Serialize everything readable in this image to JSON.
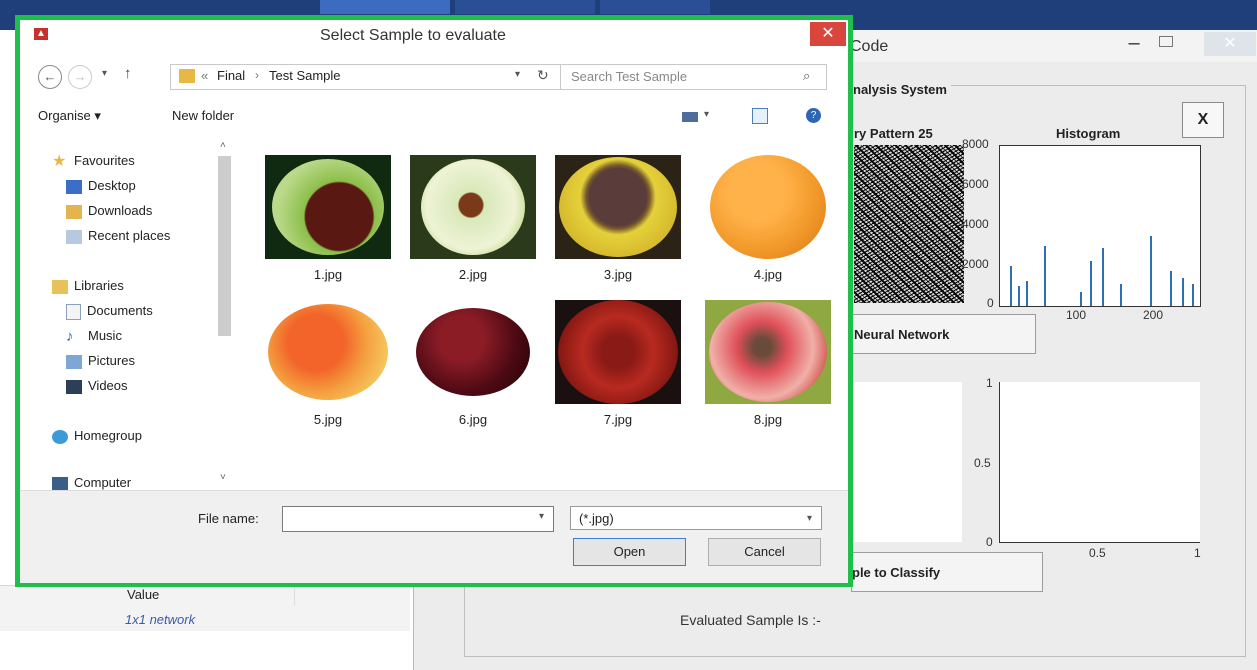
{
  "background": {
    "left_panel": {
      "value_header": "Value",
      "value_cell": "1x1 network"
    },
    "app_window": {
      "title": "Code",
      "system_title": "nalysis System",
      "close_x": "X",
      "lbp_title": "ry Pattern 25",
      "histogram_title": "Histogram",
      "histogram_yticks": [
        "8000",
        "6000",
        "4000",
        "2000",
        "0"
      ],
      "histogram_xticks": [
        "100",
        "200"
      ],
      "nn_button": "Neural Network",
      "plot_yticks": [
        "1",
        "0.5",
        "0"
      ],
      "plot_xticks": [
        "0.5",
        "1"
      ],
      "classify_button": "ple to Classify",
      "evaluated_label": "Evaluated Sample Is :-"
    }
  },
  "dialog": {
    "title": "Select Sample to evaluate",
    "close": "✕",
    "breadcrumb": [
      "«",
      "Final",
      "›",
      "Test Sample"
    ],
    "search_placeholder": "Search Test Sample",
    "organise": "Organise ▾",
    "new_folder": "New folder",
    "nav": {
      "favourites": "Favourites",
      "desktop": "Desktop",
      "downloads": "Downloads",
      "recent": "Recent places",
      "libraries": "Libraries",
      "documents": "Documents",
      "music": "Music",
      "pictures": "Pictures",
      "videos": "Videos",
      "homegroup": "Homegroup",
      "computer": "Computer"
    },
    "files": [
      "1.jpg",
      "2.jpg",
      "3.jpg",
      "4.jpg",
      "5.jpg",
      "6.jpg",
      "7.jpg",
      "8.jpg"
    ],
    "file_name_label": "File name:",
    "file_name_value": "",
    "filter": "(*.jpg)",
    "open": "Open",
    "cancel": "Cancel"
  }
}
